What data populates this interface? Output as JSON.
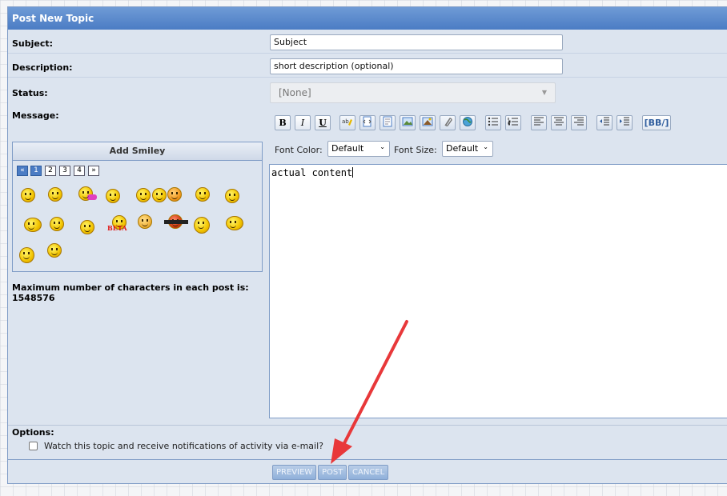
{
  "title": "Post New Topic",
  "form": {
    "subject_label": "Subject:",
    "subject_value": "Subject",
    "description_label": "Description:",
    "description_value": "short description (optional)",
    "status_label": "Status:",
    "status_value": "[None]",
    "message_label": "Message:"
  },
  "toolbar": {
    "bold": "B",
    "italic": "I",
    "underline": "U",
    "bbcode": "[BB/]",
    "icons": [
      "spellcheck-icon",
      "insert-code-icon",
      "insert-quote-icon",
      "insert-image-icon",
      "insert-photo-icon",
      "attach-icon",
      "insert-link-icon",
      "bullet-list-icon",
      "numbered-list-icon",
      "align-left-icon",
      "align-center-icon",
      "align-right-icon",
      "outdent-icon",
      "indent-icon"
    ],
    "font_color_label": "Font Color:",
    "font_color_value": "Default",
    "font_size_label": "Font Size:",
    "font_size_value": "Default"
  },
  "smileys": {
    "title": "Add Smiley",
    "pages": [
      "«",
      "1",
      "2",
      "3",
      "4",
      "»"
    ],
    "active_page": "1",
    "extra_labels": [
      "BETA"
    ]
  },
  "editor_content": "actual content",
  "max_chars_label": "Maximum number of characters in each post is:",
  "max_chars_value": "1548576",
  "options": {
    "label": "Options:",
    "watch_label": "Watch this topic and receive notifications of activity via e-mail?",
    "watch_checked": false
  },
  "buttons": {
    "preview": "PREVIEW",
    "post": "POST",
    "cancel": "CANCEL"
  },
  "colors": {
    "title_bar": "#4b7cc4",
    "panel_bg": "#dce4ef",
    "annotation_arrow": "#e8383a"
  }
}
